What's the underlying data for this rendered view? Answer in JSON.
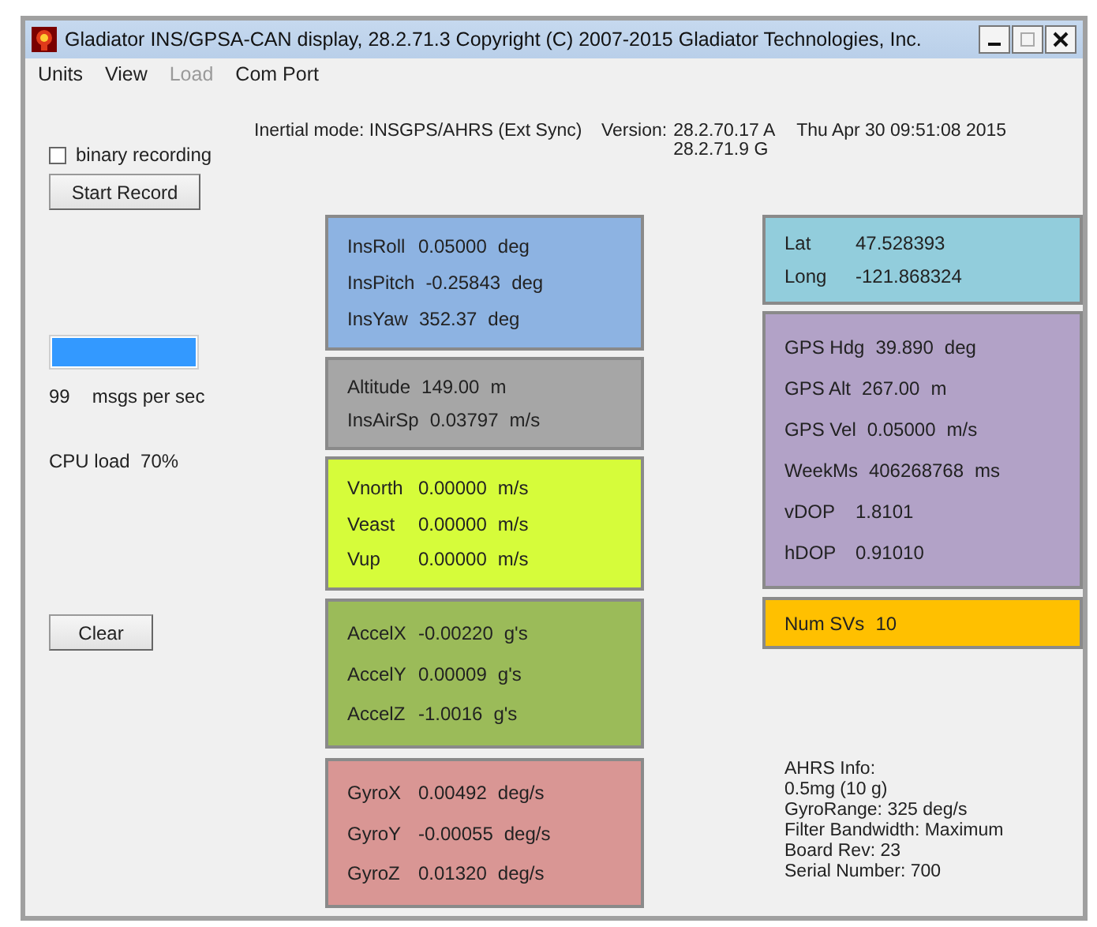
{
  "window": {
    "title": "Gladiator INS/GPSA-CAN display, 28.2.71.3 Copyright (C) 2007-2015 Gladiator Technologies, Inc."
  },
  "menu": [
    {
      "label": "Units",
      "disabled": false
    },
    {
      "label": "View",
      "disabled": false
    },
    {
      "label": "Load",
      "disabled": true
    },
    {
      "label": "Com Port",
      "disabled": false
    }
  ],
  "binary_recording": {
    "label": "binary recording",
    "checked": false
  },
  "start_record_button": "Start Record",
  "info": {
    "inertial_mode": "Inertial mode: INSGPS/AHRS (Ext Sync)",
    "version_label": "Version:",
    "versions": [
      "28.2.70.17 A",
      "28.2.71.9 G"
    ],
    "timestamp": "Thu Apr 30 09:51:08 2015"
  },
  "message_rate": {
    "level": 1,
    "count": "99",
    "unit": "msgs per sec"
  },
  "cpu_load": "CPU load  70%",
  "clear_button": "Clear",
  "center_panels": [
    {
      "color": "#8db3e2",
      "rows": [
        {
          "label": "InsRoll",
          "value": "0.05000",
          "unit": "deg"
        },
        {
          "label": "InsPitch",
          "value": "-0.25843",
          "unit": "deg"
        },
        {
          "label": "InsYaw",
          "value": "352.37",
          "unit": "deg"
        }
      ]
    },
    {
      "color": "#a6a6a6",
      "rows": [
        {
          "label": "Altitude",
          "value": "149.00",
          "unit": "m"
        },
        {
          "label": "InsAirSp",
          "value": "0.03797",
          "unit": "m/s"
        }
      ]
    },
    {
      "color": "#d6fc3a",
      "rows": [
        {
          "label": "Vnorth",
          "value": "0.00000",
          "unit": "m/s"
        },
        {
          "label": "Veast",
          "value": "0.00000",
          "unit": "m/s"
        },
        {
          "label": "Vup",
          "value": "0.00000",
          "unit": "m/s"
        }
      ]
    },
    {
      "color": "#9bbb59",
      "rows": [
        {
          "label": "AccelX",
          "value": "-0.00220",
          "unit": "g's"
        },
        {
          "label": "AccelY",
          "value": "0.00009",
          "unit": "g's"
        },
        {
          "label": "AccelZ",
          "value": "-1.0016",
          "unit": "g's"
        }
      ]
    },
    {
      "color": "#d99694",
      "rows": [
        {
          "label": "GyroX",
          "value": "0.00492",
          "unit": "deg/s"
        },
        {
          "label": "GyroY",
          "value": "-0.00055",
          "unit": "deg/s"
        },
        {
          "label": "GyroZ",
          "value": "0.01320",
          "unit": "deg/s"
        }
      ]
    }
  ],
  "right_panels": [
    {
      "color": "#92cddc",
      "rows": [
        {
          "label": "Lat",
          "value": "47.528393"
        },
        {
          "label": "Long",
          "value": "-121.868324"
        }
      ]
    },
    {
      "color": "#b2a2c7",
      "rows": [
        {
          "label": "GPS Hdg",
          "value": "39.890",
          "unit": "deg"
        },
        {
          "label": "GPS Alt",
          "value": "267.00",
          "unit": "m"
        },
        {
          "label": "GPS Vel",
          "value": "0.05000",
          "unit": "m/s"
        },
        {
          "label": "WeekMs",
          "value": "406268768",
          "unit": "ms"
        },
        {
          "label": "vDOP",
          "value": "1.8101"
        },
        {
          "label": "hDOP",
          "value": "0.91010"
        }
      ]
    },
    {
      "color": "#ffc000",
      "rows": [
        {
          "label": "Num SVs",
          "value": "10"
        }
      ]
    }
  ],
  "ahrs_info": [
    "AHRS Info:",
    "0.5mg (10 g)",
    "GyroRange:  325 deg/s",
    "Filter Bandwidth: Maximum",
    "Board Rev: 23",
    "Serial Number: 700"
  ]
}
